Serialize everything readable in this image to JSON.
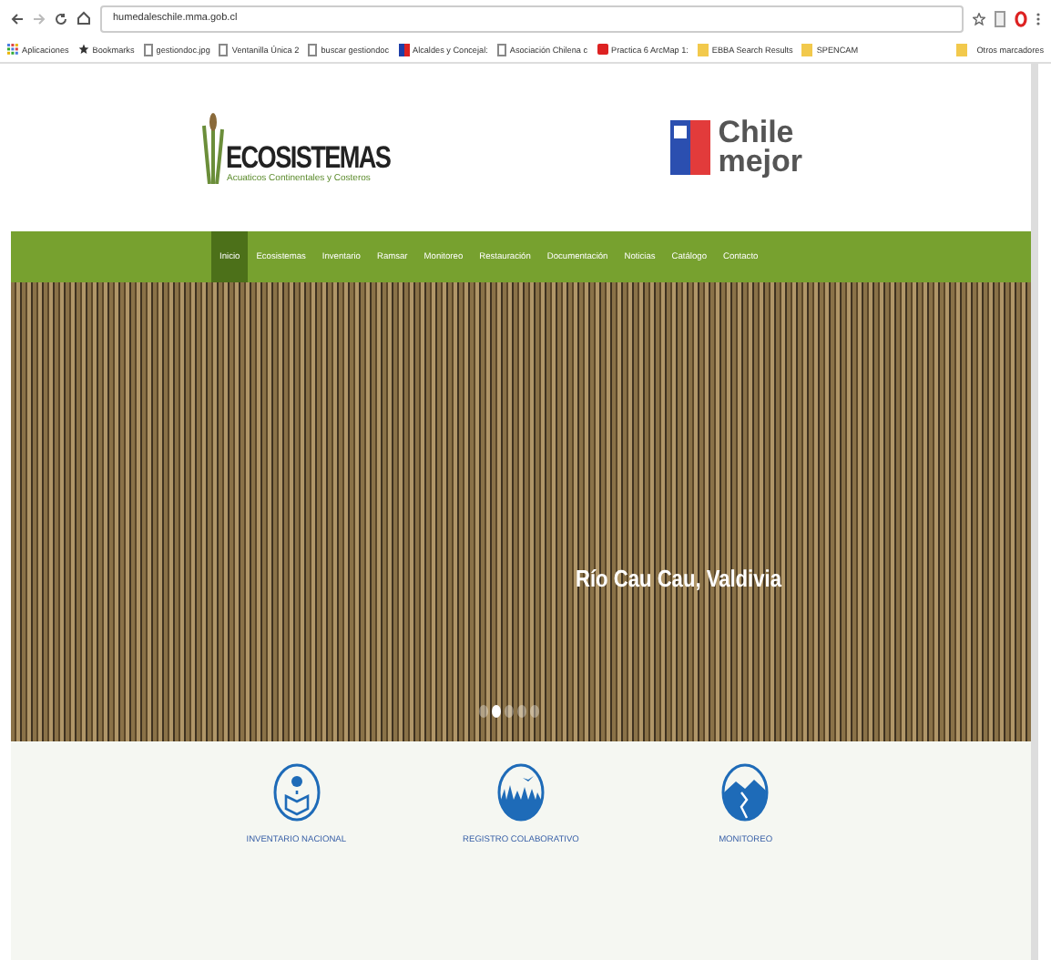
{
  "browser": {
    "url": "humedaleschile.mma.gob.cl",
    "bookmarks": [
      {
        "label": "Aplicaciones",
        "kind": "apps"
      },
      {
        "label": "Bookmarks",
        "kind": "star"
      },
      {
        "label": "gestiondoc.jpg",
        "kind": "page"
      },
      {
        "label": "Ventanilla Única 2",
        "kind": "page"
      },
      {
        "label": "buscar gestiondoc",
        "kind": "page"
      },
      {
        "label": "Alcaldes y Concejal:",
        "kind": "flag"
      },
      {
        "label": "Asociación Chilena c",
        "kind": "page"
      },
      {
        "label": "Practica 6 ArcMap 1:",
        "kind": "red"
      },
      {
        "label": "EBBA Search Results",
        "kind": "folder"
      },
      {
        "label": "SPENCAM",
        "kind": "folder"
      }
    ],
    "other_bookmarks": "Otros marcadores"
  },
  "header": {
    "logo_title": "ECOSISTEMAS",
    "logo_subtitle": "Acuaticos Continentales y Costeros",
    "gov_line1": "Chile",
    "gov_line2": "mejor"
  },
  "nav": [
    {
      "label": "Inicio",
      "selected": true
    },
    {
      "label": "Ecosistemas",
      "selected": false
    },
    {
      "label": "Inventario",
      "selected": false
    },
    {
      "label": "Ramsar",
      "selected": false
    },
    {
      "label": "Monitoreo",
      "selected": false
    },
    {
      "label": "Restauración",
      "selected": false
    },
    {
      "label": "Documentación",
      "selected": false
    },
    {
      "label": "Noticias",
      "selected": false
    },
    {
      "label": "Catálogo",
      "selected": false
    },
    {
      "label": "Contacto",
      "selected": false
    }
  ],
  "hero": {
    "caption": "Río Cau Cau, Valdivia",
    "dots": [
      {
        "selected": false
      },
      {
        "selected": true
      },
      {
        "selected": false
      },
      {
        "selected": false
      },
      {
        "selected": false
      }
    ]
  },
  "features": [
    {
      "label": "INVENTARIO NACIONAL",
      "kind": "map"
    },
    {
      "label": "REGISTRO COLABORATIVO",
      "kind": "bird"
    },
    {
      "label": "MONITOREO",
      "kind": "mountain"
    }
  ]
}
